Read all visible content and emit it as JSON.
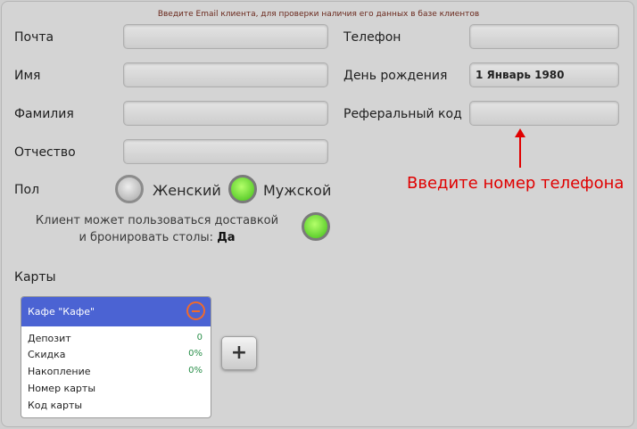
{
  "hint": "Введите Email клиента, для проверки наличия его данных в базе клиентов",
  "fields": {
    "email_label": "Почта",
    "phone_label": "Телефон",
    "name_label": "Имя",
    "birthday_label": "День рождения",
    "birthday_value": "1 Январь 1980",
    "surname_label": "Фамилия",
    "referral_label": "Реферальный код",
    "patronymic_label": "Отчество"
  },
  "gender": {
    "label": "Пол",
    "female": "Женский",
    "male": "Мужской",
    "selected": "male"
  },
  "access": {
    "text": "Клиент может пользоваться доставкой и бронировать столы:",
    "value": "Да"
  },
  "annotation": "Введите номер телефона",
  "cards": {
    "label": "Карты",
    "add_label": "+",
    "items": [
      {
        "title": "Кафе \"Кафе\"",
        "deposit_label": "Депозит",
        "deposit_value": "0",
        "discount_label": "Скидка",
        "discount_value": "0%",
        "accum_label": "Накопление",
        "accum_value": "0%",
        "number_label": "Номер карты",
        "code_label": "Код карты"
      }
    ]
  },
  "colors": {
    "accent": "#4b63d3",
    "annotation": "#e00000",
    "toggle_on": "#3fbd18"
  }
}
